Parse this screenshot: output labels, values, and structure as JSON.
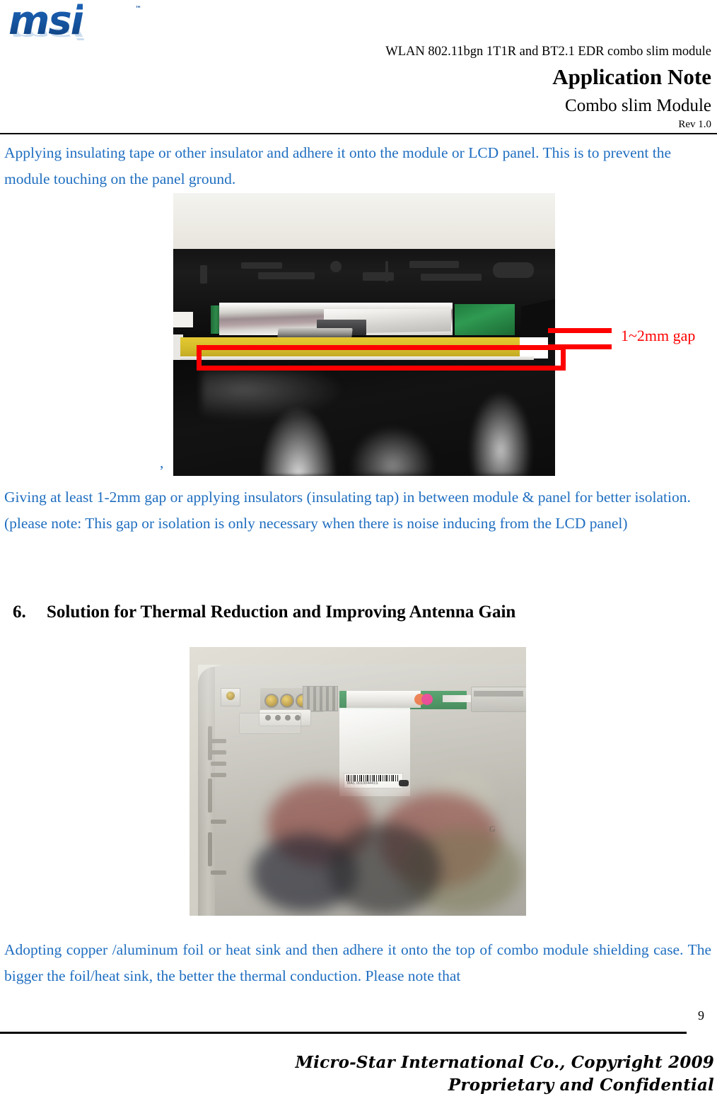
{
  "document": {
    "header": {
      "logo_text": "msi",
      "logo_tm": "™",
      "product_line": "WLAN 802.11bgn 1T1R and BT2.1 EDR combo slim module",
      "title": "Application Note",
      "subtitle": "Combo slim Module",
      "revision": "Rev 1.0"
    },
    "body": {
      "paragraph_1": "Applying insulating tape or other insulator and adhere it onto the module or LCD panel. This is to prevent the module touching on the panel ground.",
      "figure_1_trailing_comma": ",",
      "paragraph_2": "Giving at least 1-2mm gap or applying insulators (insulating tap) in between module & panel for better isolation. (please note: This gap or isolation is only necessary when there is noise inducing from the LCD panel)",
      "section_6_number": "6.",
      "section_6_title": "Solution for Thermal Reduction and Improving Antenna Gain",
      "paragraph_3": "Adopting copper /aluminum foil or heat sink and then adhere it onto the top of combo module shielding case. The bigger the foil/heat sink, the better the thermal conduction.   Please note that"
    },
    "figure_1": {
      "caption_annotation": "1~2mm gap",
      "annotation_color": "#ff0000",
      "description": "Photo of LCD panel bezel with combo slim module wrapped in silver foil and yellow insulating tape applied below",
      "tape_color": "#d9c02c",
      "pcb_color": "#2f8a4b"
    },
    "figure_2": {
      "description": "Photo of laptop chassis cover showing combo module with copper/aluminum foil heat sink adhered on top",
      "label_text": "MAC 001004441S"
    },
    "footer": {
      "page_number": "9",
      "company_line": "Micro-Star International Co., Copyright 2009",
      "confidential_line": "Proprietary and Confidential"
    },
    "colors": {
      "body_text_blue": "#1f6ec0",
      "logo_blue": "#15539e",
      "annotation_red": "#ff0000",
      "heading_black": "#000000"
    }
  }
}
